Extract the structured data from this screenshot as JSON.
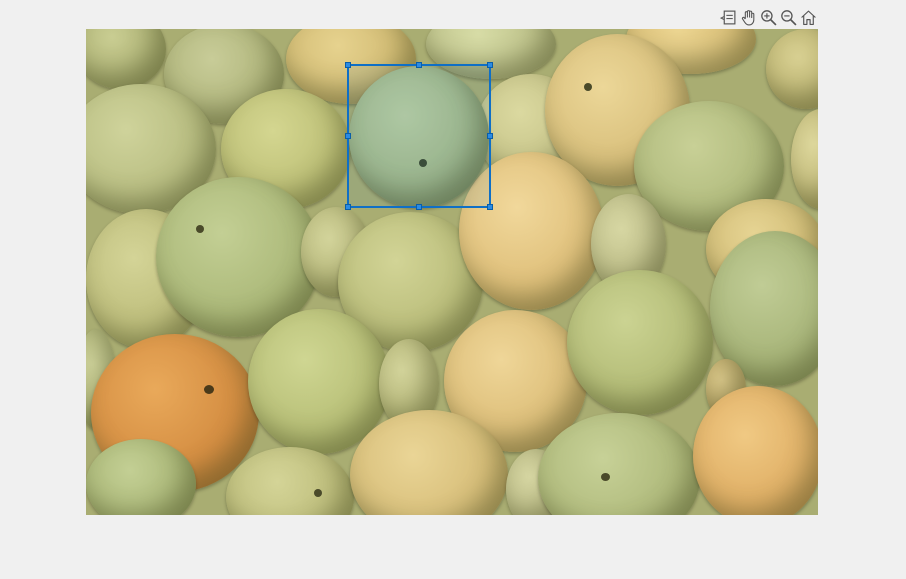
{
  "figure": {
    "background_color": "#f0f0f0",
    "roi_color": "#0f6fc6"
  },
  "toolbar": {
    "buttons": [
      {
        "name": "data-tips-button",
        "icon": "data-tip-icon"
      },
      {
        "name": "pan-button",
        "icon": "hand-icon"
      },
      {
        "name": "zoom-in-button",
        "icon": "zoom-in-icon"
      },
      {
        "name": "zoom-out-button",
        "icon": "zoom-out-icon"
      },
      {
        "name": "restore-view-button",
        "icon": "home-icon"
      }
    ]
  },
  "image": {
    "subject": "pears",
    "roi": {
      "shape": "rectangle",
      "handles": 8
    }
  }
}
